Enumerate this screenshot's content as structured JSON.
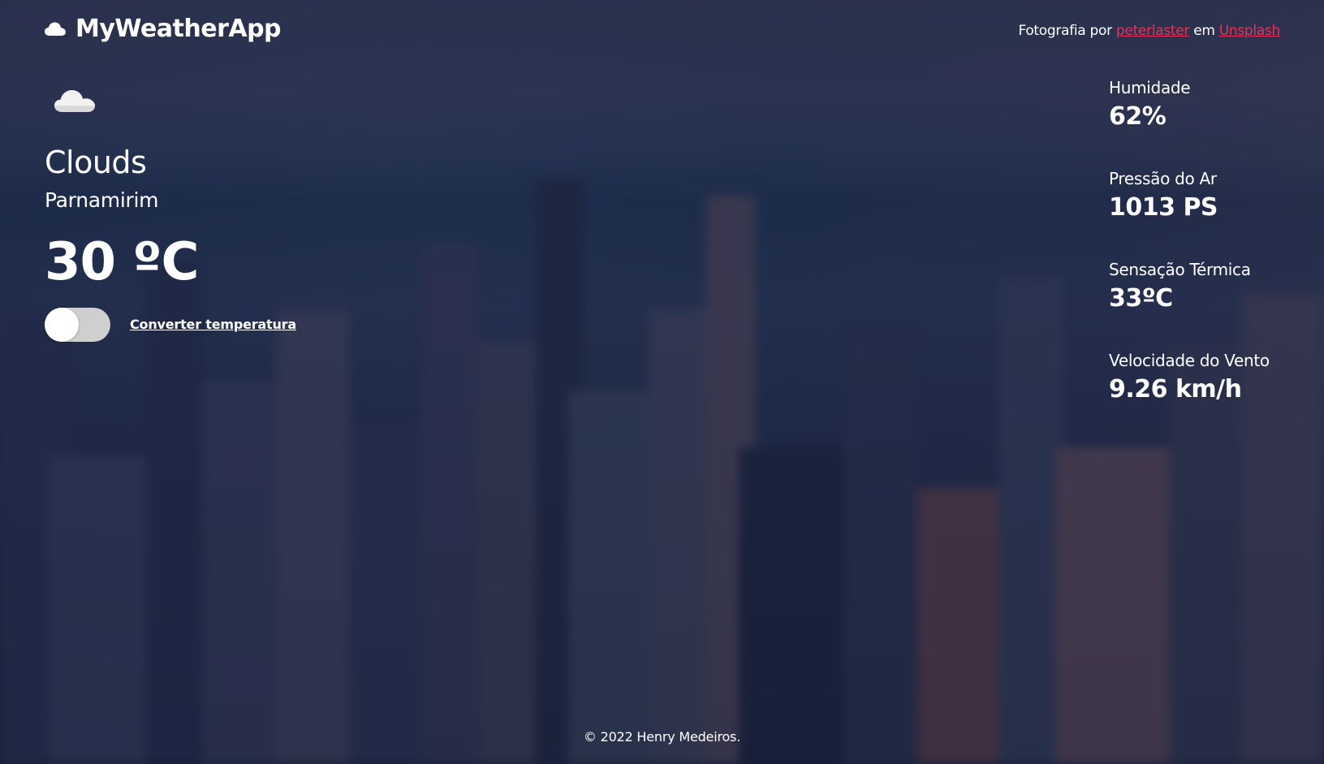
{
  "header": {
    "app_title": "MyWeatherApp",
    "logo_icon": "cloud-icon"
  },
  "credit": {
    "prefix": "Fotografia por",
    "author": "peterlaster",
    "middle": "em",
    "source": "Unsplash",
    "link_color": "#e8325a"
  },
  "current": {
    "icon": "cloud-icon",
    "condition": "Clouds",
    "city": "Parnamirim",
    "temperature": "30 ºC"
  },
  "converter": {
    "label": "Converter temperatura",
    "toggle_on": false
  },
  "stats": [
    {
      "label": "Humidade",
      "value": "62%"
    },
    {
      "label": "Pressão do Ar",
      "value": "1013 PS"
    },
    {
      "label": "Sensação Térmica",
      "value": "33ºC"
    },
    {
      "label": "Velocidade do Vento",
      "value": "9.26 km/h"
    }
  ],
  "footer": {
    "text": "© 2022 Henry Medeiros."
  }
}
